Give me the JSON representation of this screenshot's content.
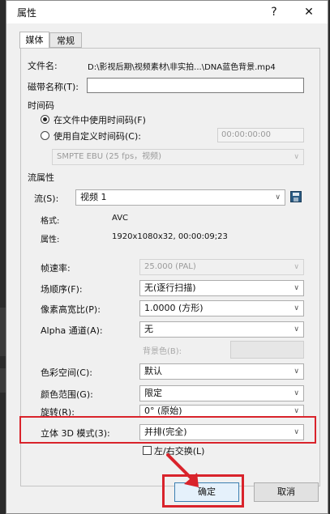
{
  "dialog": {
    "title": "属性",
    "help_label": "?",
    "close_label": "✕",
    "tabs": [
      {
        "label": "媒体",
        "active": true
      },
      {
        "label": "常规",
        "active": false
      }
    ]
  },
  "media": {
    "filename_label": "文件名:",
    "filename_value": "D:\\影视后期\\视频素材\\非实拍...\\DNA蓝色背景.mp4",
    "tape_label": "磁带名称(T):",
    "tape_value": "",
    "timecode_section": "时间码",
    "timecode_from_file": "在文件中使用时间码(F)",
    "timecode_custom": "使用自定义时间码(C):",
    "timecode_custom_value": "00:00:00:00",
    "timecode_format": "SMPTE EBU (25 fps，视频)",
    "stream_section": "流属性",
    "stream_label": "流(S):",
    "stream_value": "视频 1",
    "format_label": "格式:",
    "format_value": "AVC",
    "attrs_label": "属性:",
    "attrs_value": "1920x1080x32, 00:00:09;23",
    "framerate_label": "帧速率:",
    "framerate_value": "25.000 (PAL)",
    "field_order_label": "场顺序(F):",
    "field_order_value": "无(逐行扫描)",
    "pixel_aspect_label": "像素高宽比(P):",
    "pixel_aspect_value": "1.0000 (方形)",
    "alpha_label": "Alpha 通道(A):",
    "alpha_value": "无",
    "bgcolor_label": "背景色(B):",
    "colorspace_label": "色彩空间(C):",
    "colorspace_value": "默认",
    "color_range_label": "颜色范围(G):",
    "color_range_value": "限定",
    "rotation_label": "旋转(R):",
    "rotation_value": "0° (原始)",
    "stereo_label": "立体 3D 模式(3):",
    "stereo_value": "并排(完全)",
    "swap_label": "左/右交换(L)"
  },
  "buttons": {
    "ok": "确定",
    "cancel": "取消"
  },
  "colors": {
    "highlight": "#d9232b"
  }
}
